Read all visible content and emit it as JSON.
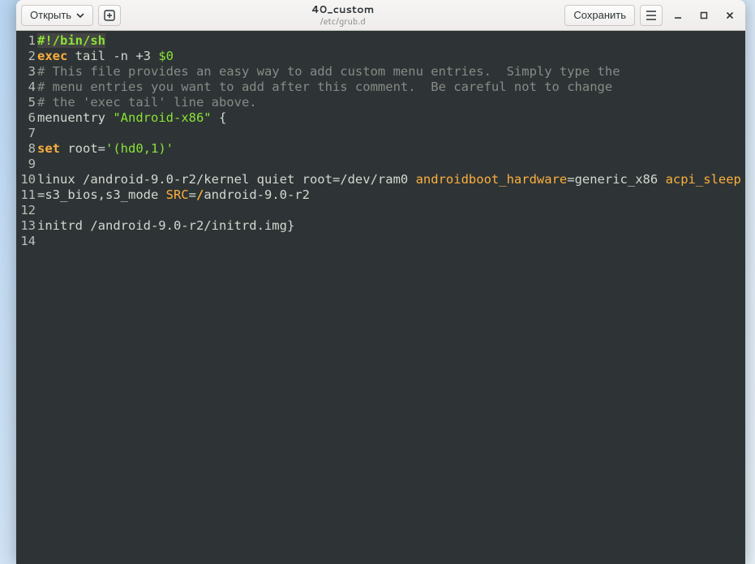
{
  "header": {
    "open_label": "Открыть",
    "save_label": "Сохранить",
    "title": "40_custom",
    "subtitle": "/etc/grub.d"
  },
  "gutter": [
    "1",
    "2",
    "3",
    "4",
    "5",
    "6",
    "7",
    "8",
    "9",
    "10",
    "11",
    "12",
    "13",
    "14"
  ],
  "code": {
    "l1_shebang": "#!/bin/sh",
    "l2_exec": "exec",
    "l2_rest": " tail -n +3 ",
    "l2_var": "$0",
    "l3": "# This file provides an easy way to add custom menu entries.  Simply type the",
    "l4": "# menu entries you want to add after this comment.  Be careful not to change",
    "l5": "# the 'exec tail' line above.",
    "l6_a": "menuentry ",
    "l6_str": "\"Android-x86\"",
    "l6_b": " {",
    "l8_set": "set",
    "l8_a": " root=",
    "l8_str": "'(hd0,1)'",
    "l10": "linux /android-9.0-r2/kernel quiet root=/dev/ram0 ",
    "l11_a": "androidboot_hardware",
    "l11_b": "=generic_x86 ",
    "l11_c": "acpi_sleep",
    "l11_d": "=s3_bios,s3_mode ",
    "l11_e": "SRC",
    "l11_f": "=",
    "l11_g": "/",
    "l11_h": "android-9.0-r2",
    "l14": "initrd /android-9.0-r2/initrd.img}"
  }
}
